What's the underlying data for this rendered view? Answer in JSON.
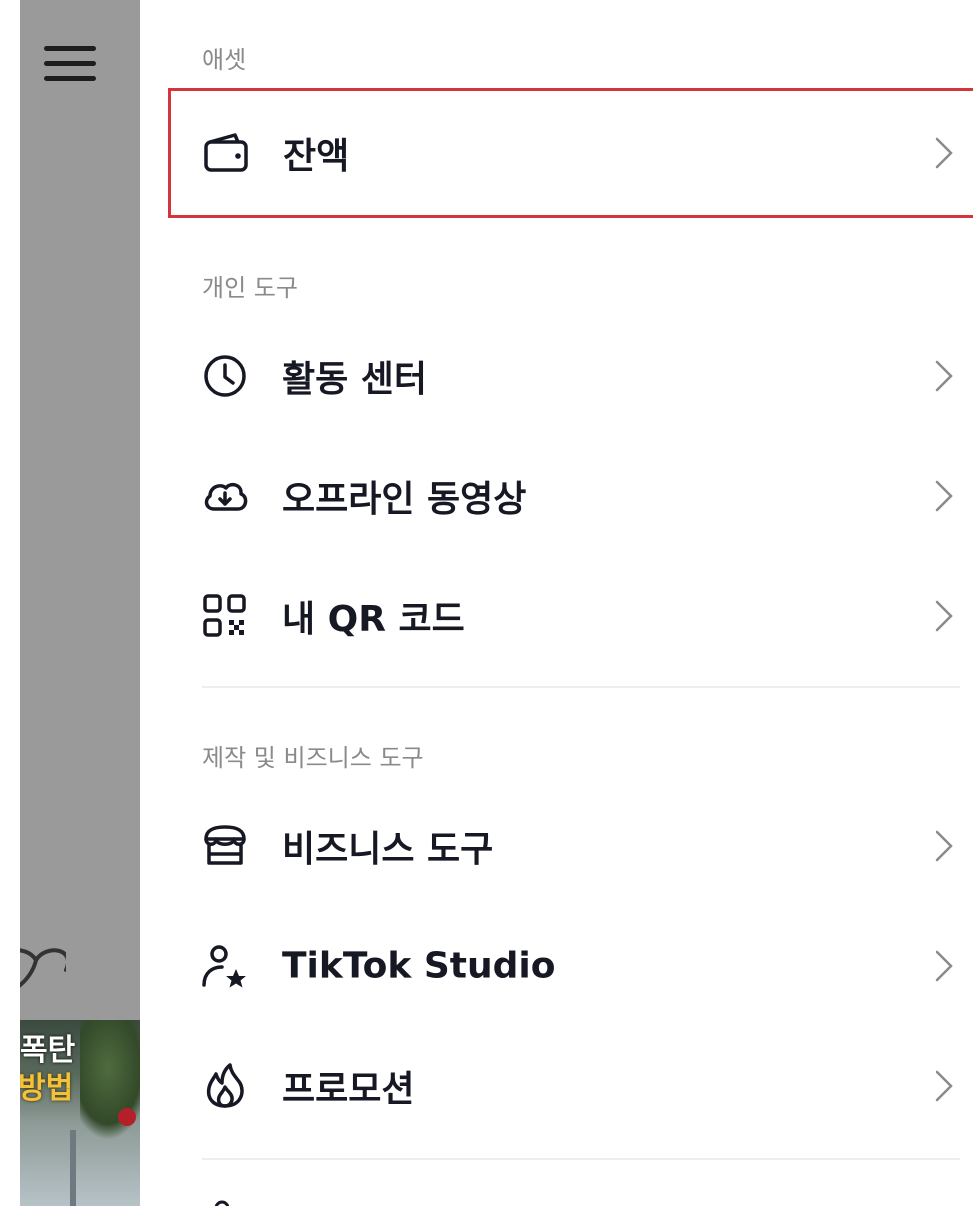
{
  "sections": {
    "assets": {
      "label": "애셋",
      "items": [
        {
          "label": "잔액",
          "icon": "wallet-icon",
          "highlighted": true
        }
      ]
    },
    "personal_tools": {
      "label": "개인 도구",
      "items": [
        {
          "label": "활동 센터",
          "icon": "clock-icon"
        },
        {
          "label": "오프라인 동영상",
          "icon": "cloud-download-icon"
        },
        {
          "label": "내 QR 코드",
          "icon": "qr-code-icon"
        }
      ]
    },
    "creator_business_tools": {
      "label": "제작 및 비즈니스 도구",
      "items": [
        {
          "label": "비즈니스 도구",
          "icon": "store-icon"
        },
        {
          "label": "TikTok Studio",
          "icon": "person-star-icon"
        },
        {
          "label": "프로모션",
          "icon": "flame-icon"
        }
      ]
    }
  },
  "background": {
    "thumbnail_line1": "폭탄",
    "thumbnail_line2": "방법"
  },
  "colors": {
    "highlight_border": "#d6343d",
    "section_label": "#8a8a8a",
    "item_text": "#161823",
    "overlay": "#9a9a9a"
  }
}
